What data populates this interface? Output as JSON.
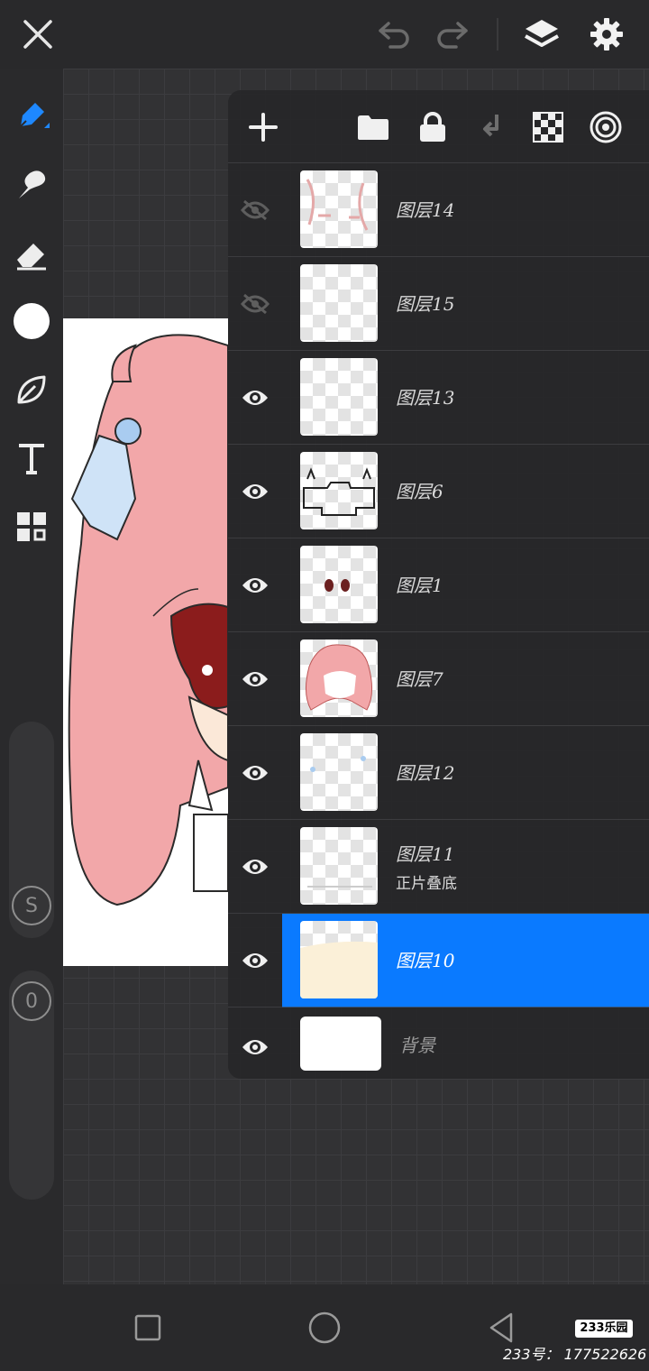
{
  "layers": [
    {
      "name": "图层14",
      "visible": false,
      "mode": ""
    },
    {
      "name": "图层15",
      "visible": false,
      "mode": ""
    },
    {
      "name": "图层13",
      "visible": true,
      "mode": ""
    },
    {
      "name": "图层6",
      "visible": true,
      "mode": ""
    },
    {
      "name": "图层1",
      "visible": true,
      "mode": ""
    },
    {
      "name": "图层7",
      "visible": true,
      "mode": ""
    },
    {
      "name": "图层12",
      "visible": true,
      "mode": ""
    },
    {
      "name": "图层11",
      "visible": true,
      "mode": "正片叠底"
    },
    {
      "name": "图层10",
      "visible": true,
      "mode": "",
      "selected": true
    },
    {
      "name": "背景",
      "visible": true,
      "mode": ""
    }
  ],
  "sidebar": {
    "slider1_label": "S",
    "slider2_label": "0"
  },
  "watermark": {
    "logo": "233乐园",
    "text": "233号： 177522626"
  },
  "colors": {
    "accent": "#0a7aff",
    "current_color": "#ffffff"
  }
}
